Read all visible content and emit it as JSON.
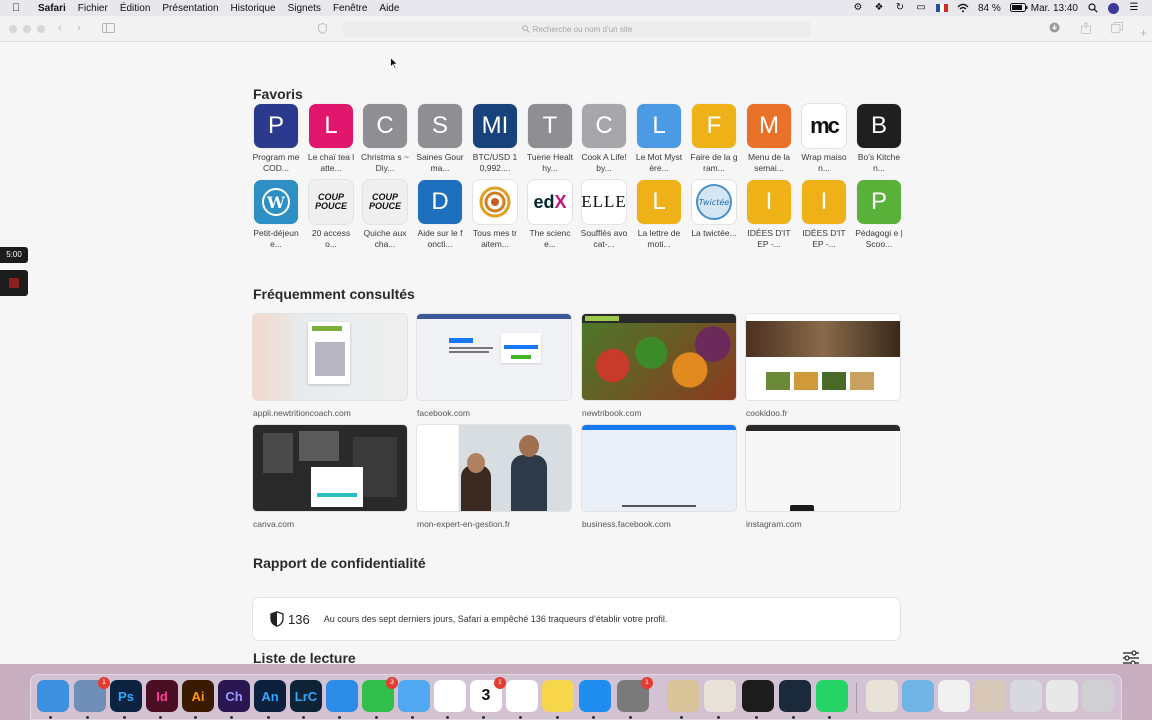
{
  "menubar": {
    "app": "Safari",
    "items": [
      "Fichier",
      "Édition",
      "Présentation",
      "Historique",
      "Signets",
      "Fenêtre",
      "Aide"
    ],
    "battery": "84 %",
    "clock": "Mar. 13:40"
  },
  "toolbar": {
    "search_placeholder": "Recherche ou nom d’un site"
  },
  "favorites": {
    "title": "Favoris",
    "items": [
      {
        "letter": "P",
        "label": "Program me COD...",
        "color": "#2c3a8e"
      },
      {
        "letter": "L",
        "label": "Le chaï tea latte...",
        "color": "#e0176d"
      },
      {
        "letter": "C",
        "label": "Christma s ~ Diy...",
        "color": "#8e8e93"
      },
      {
        "letter": "S",
        "label": "Saines Gourma...",
        "color": "#8e8e93"
      },
      {
        "letter": "MI",
        "label": "BTC/USD 10,992....",
        "color": "#17427a"
      },
      {
        "letter": "T",
        "label": "Tuerie Healthy...",
        "color": "#8e8e93"
      },
      {
        "letter": "C",
        "label": "Cook A Life! by...",
        "color": "#a7a7ab"
      },
      {
        "letter": "L",
        "label": "Le Mot Mystère...",
        "color": "#4b9ae3"
      },
      {
        "letter": "F",
        "label": "Faire de la gram...",
        "color": "#eeb218"
      },
      {
        "letter": "M",
        "label": "Menu de la semai...",
        "color": "#e9712a"
      },
      {
        "letter": "mc",
        "label": "Wrap maison...",
        "color": "#ffffff"
      },
      {
        "letter": "B",
        "label": "Bo's Kitchen...",
        "color": "#1f1f1f"
      },
      {
        "letter": "W",
        "label": "Petit-déjeune...",
        "color": "#2d8fc4"
      },
      {
        "letter": "COUP POUCE",
        "label": "20 accesso...",
        "color": "#efefef"
      },
      {
        "letter": "COUP POUCE",
        "label": "Quiche aux cha...",
        "color": "#efefef"
      },
      {
        "letter": "D",
        "label": "Aide sur le foncti...",
        "color": "#1f6fbf"
      },
      {
        "letter": "",
        "label": "Tous mes traitem...",
        "color": "#ffffff"
      },
      {
        "letter": "edX",
        "label": "The science...",
        "color": "#ffffff"
      },
      {
        "letter": "ELLE",
        "label": "Soufflés avocat-...",
        "color": "#ffffff"
      },
      {
        "letter": "L",
        "label": "La lettre de moti...",
        "color": "#eeb218"
      },
      {
        "letter": "",
        "label": "La twictée...",
        "color": "#ffffff"
      },
      {
        "letter": "I",
        "label": "IDÉES D'ITEP -...",
        "color": "#eeb218"
      },
      {
        "letter": "I",
        "label": "IDÉES D'ITEP -...",
        "color": "#eeb218"
      },
      {
        "letter": "P",
        "label": "Pédagogi e | Scoo...",
        "color": "#5ab13a"
      }
    ]
  },
  "frequent": {
    "title": "Fréquemment consultés",
    "items": [
      {
        "site": "appli.newtritioncoach.com"
      },
      {
        "site": "facebook.com"
      },
      {
        "site": "newtribook.com"
      },
      {
        "site": "cookidoo.fr"
      },
      {
        "site": "canva.com"
      },
      {
        "site": "mon-expert-en-gestion.fr"
      },
      {
        "site": "business.facebook.com"
      },
      {
        "site": "instagram.com"
      }
    ]
  },
  "privacy": {
    "title": "Rapport de confidentialité",
    "count": "136",
    "text": "Au cours des sept derniers jours, Safari a empêché 136 traqueurs d’établir votre profil."
  },
  "reading_list": {
    "title": "Liste de lecture"
  },
  "overlay": {
    "timer": "5:00"
  },
  "dock": {
    "items": [
      {
        "name": "finder",
        "label": "",
        "color": "#3d8fe0"
      },
      {
        "name": "preview",
        "label": "",
        "color": "#6f8fb8",
        "badge": "1"
      },
      {
        "name": "photoshop",
        "label": "Ps",
        "color": "#0b2340"
      },
      {
        "name": "indesign",
        "label": "Id",
        "color": "#4a0f22"
      },
      {
        "name": "illustrator",
        "label": "Ai",
        "color": "#3a1a02"
      },
      {
        "name": "character-animator",
        "label": "Ch",
        "color": "#2a1650"
      },
      {
        "name": "animate",
        "label": "An",
        "color": "#0c1f3c"
      },
      {
        "name": "lightroom-classic",
        "label": "LrC",
        "color": "#0e2436"
      },
      {
        "name": "safari",
        "label": "",
        "color": "#2c8ce8"
      },
      {
        "name": "facetime",
        "label": "",
        "color": "#2fbf4a",
        "badge": "3"
      },
      {
        "name": "messages",
        "label": "",
        "color": "#4fa8f0"
      },
      {
        "name": "photos",
        "label": "",
        "color": "#ffffff"
      },
      {
        "name": "calendar",
        "label": "3",
        "color": "#ffffff",
        "badge": "1"
      },
      {
        "name": "reminders",
        "label": "",
        "color": "#ffffff"
      },
      {
        "name": "notes",
        "label": "",
        "color": "#f6d64a"
      },
      {
        "name": "app-store",
        "label": "",
        "color": "#1f8cf0"
      },
      {
        "name": "system-preferences",
        "label": "",
        "color": "#7a7a7a",
        "badge": "1"
      },
      {
        "name": "keychain",
        "label": "",
        "color": "#d9c49a"
      },
      {
        "name": "script-editor",
        "label": "",
        "color": "#e8e2d8"
      },
      {
        "name": "activity-monitor",
        "label": "",
        "color": "#1c1c1c"
      },
      {
        "name": "kindle",
        "label": "",
        "color": "#1a2a3a"
      },
      {
        "name": "whatsapp",
        "label": "",
        "color": "#25d366"
      },
      {
        "name": "home-folder",
        "label": "",
        "color": "#e8e2d8"
      },
      {
        "name": "applications-folder",
        "label": "",
        "color": "#6fb4e4"
      },
      {
        "name": "file-doc",
        "label": "",
        "color": "#f0f0f0"
      },
      {
        "name": "screenshot-1",
        "label": "",
        "color": "#d8c8b8"
      },
      {
        "name": "screenshot-2",
        "label": "",
        "color": "#d8d8e0"
      },
      {
        "name": "screenshot-3",
        "label": "",
        "color": "#e8e8e8"
      },
      {
        "name": "trash",
        "label": "",
        "color": "#d0d0d4"
      }
    ]
  }
}
